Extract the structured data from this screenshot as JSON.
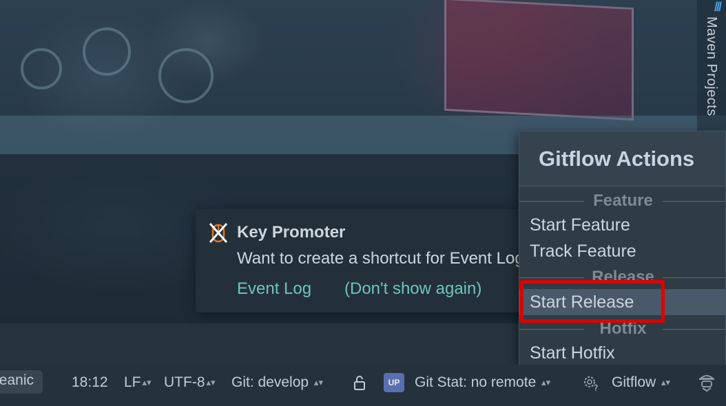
{
  "tool_window": {
    "maven_label": "Maven Projects"
  },
  "notification": {
    "icon": "key-promoter-crossed-mouse-icon",
    "title": "Key Promoter",
    "body": "Want to create a shortcut for Event Log",
    "links": {
      "event_log": "Event Log",
      "dont_show": "(Don't show again)"
    }
  },
  "gitflow_popup": {
    "title": "Gitflow Actions",
    "sections": [
      {
        "label": "Feature",
        "items": [
          "Start Feature",
          "Track Feature"
        ]
      },
      {
        "label": "Release",
        "items": [
          "Start Release"
        ]
      },
      {
        "label": "Hotfix",
        "items": [
          "Start Hotfix"
        ]
      }
    ],
    "selected_item": "Start Release",
    "highlight_color": "#e00000"
  },
  "statusbar": {
    "theme_label": "eanic",
    "position": "18:12",
    "line_separator": "LF",
    "encoding": "UTF-8",
    "git_branch": "Git: develop",
    "lock_icon": "unlocked-padlock-icon",
    "upsource_icon_text": "UP",
    "git_stat": "Git Stat: no remote",
    "gitflow": "Gitflow"
  },
  "colors": {
    "link": "#6fc4bd",
    "popup_bg": "#2f3c46",
    "selected_bg": "#49596a",
    "statusbar_bg": "#26323b"
  }
}
